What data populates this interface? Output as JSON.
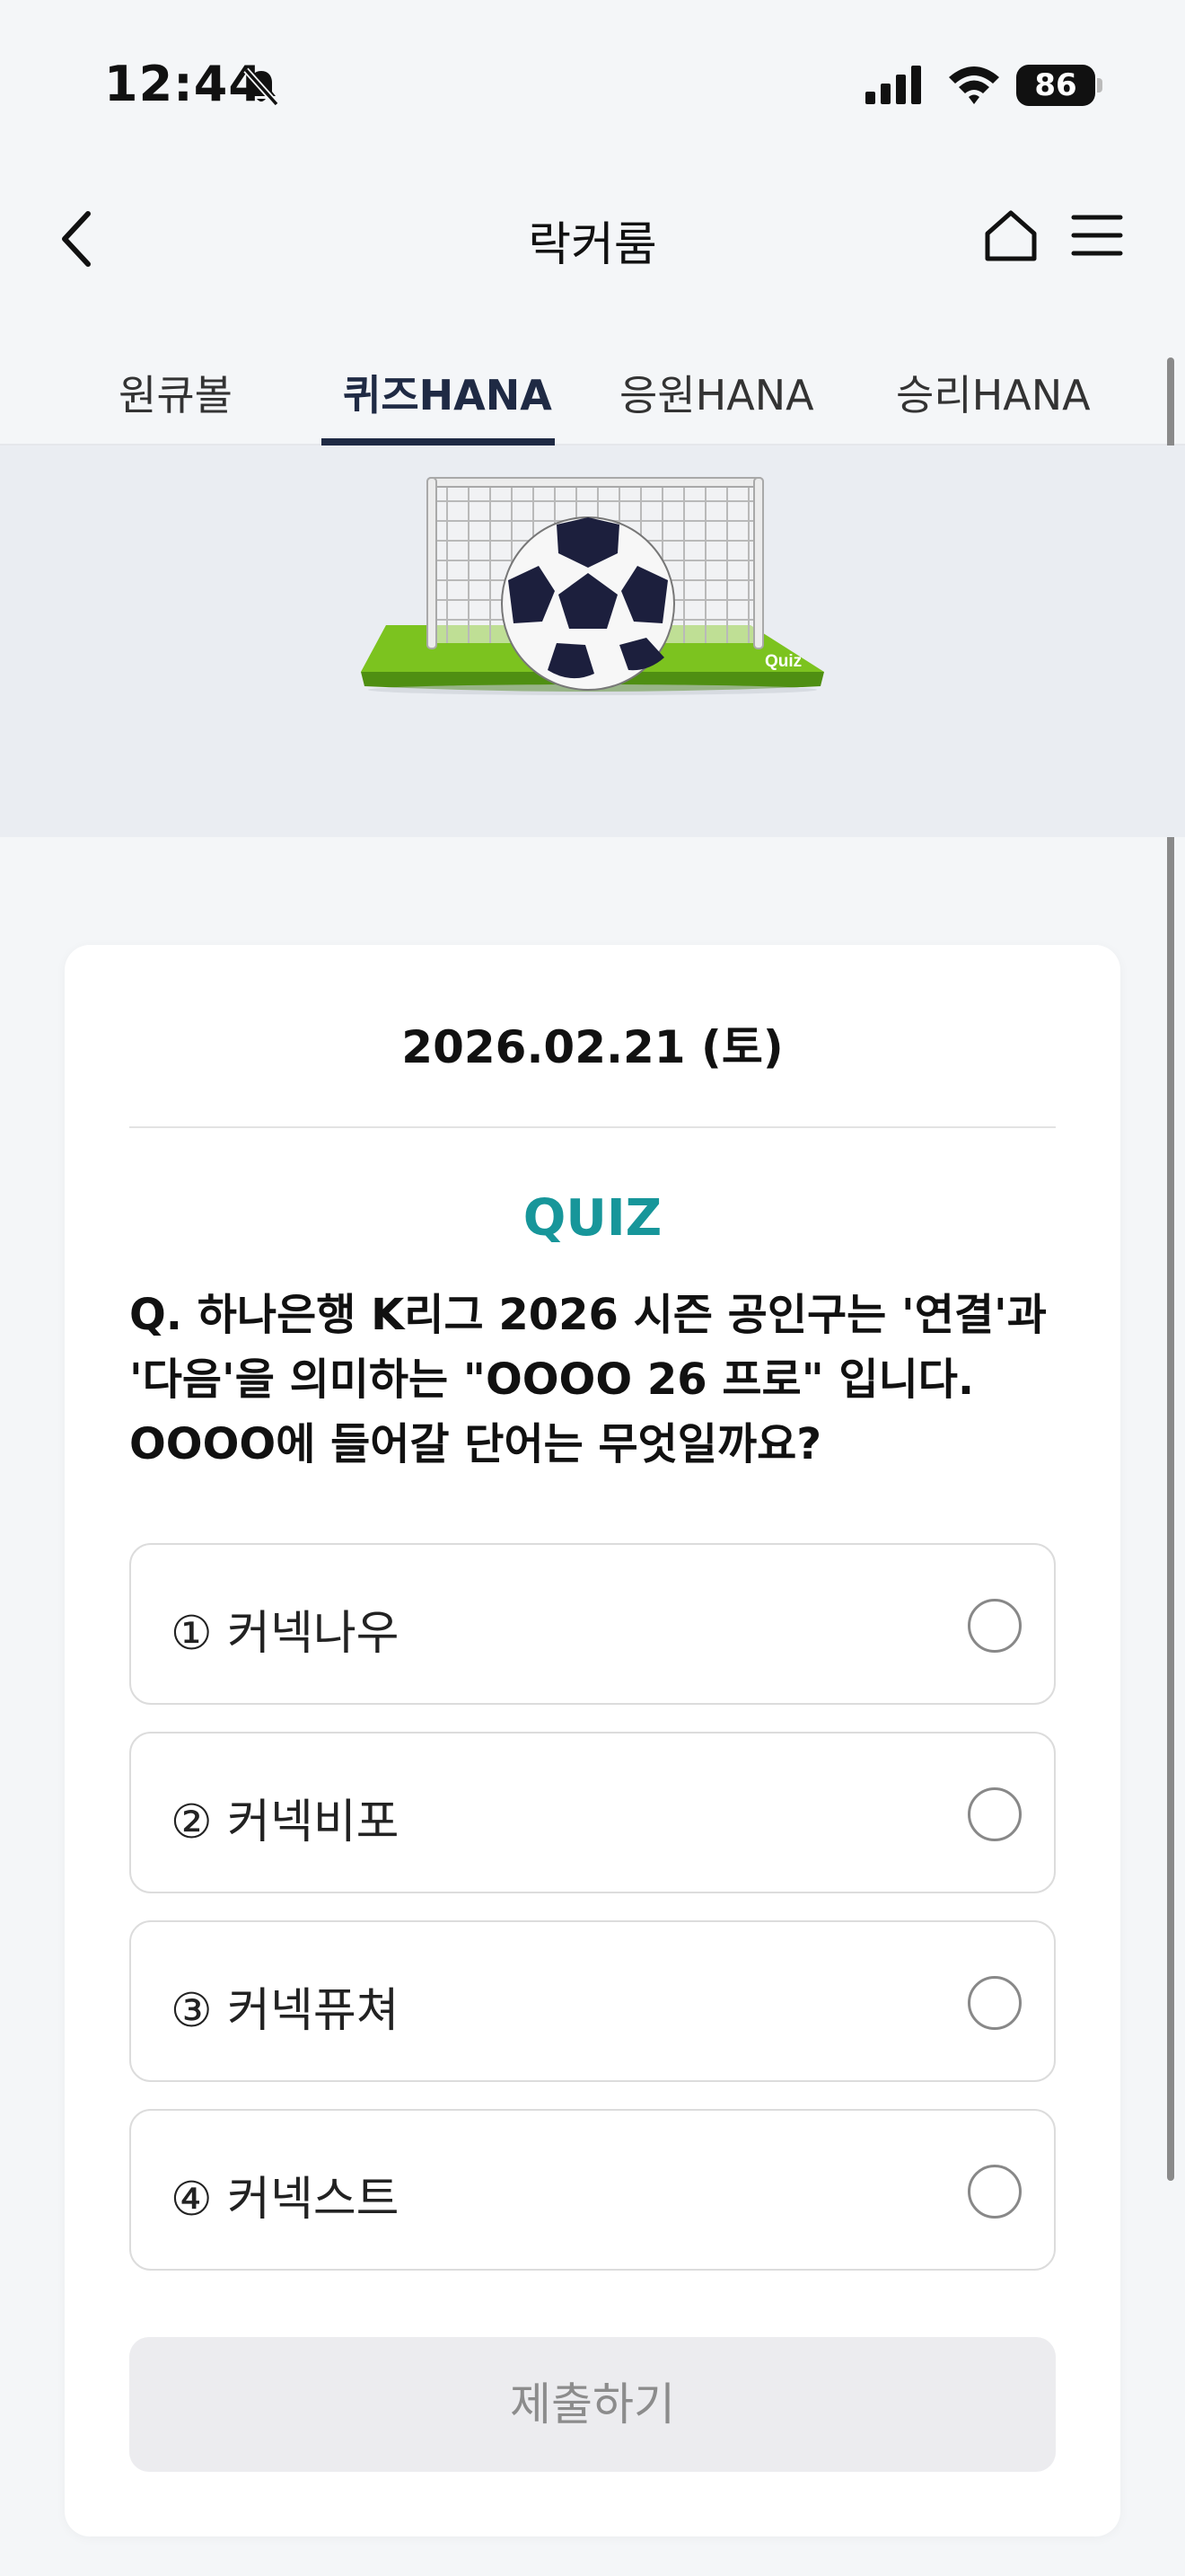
{
  "status_bar": {
    "time": "12:44",
    "battery": "86"
  },
  "header": {
    "title": "락커룸"
  },
  "tabs": [
    {
      "label": "원큐볼",
      "active": false
    },
    {
      "label": "퀴즈HANA",
      "active": true
    },
    {
      "label": "응원HANA",
      "active": false
    },
    {
      "label": "승리HANA",
      "active": false
    }
  ],
  "banner": {
    "badge": "Quiz"
  },
  "quiz": {
    "date": "2026.02.21 (토)",
    "label": "QUIZ",
    "question_lines": [
      "Q. 하나은행 K리그 2026 시즌 공인구는 '연결'과",
      "'다음'을 의미하는 \"OOOO 26 프로\" 입니다.",
      "OOOO에 들어갈 단어는 무엇일까요?"
    ],
    "options": [
      {
        "label": "① 커넥나우",
        "selected": false
      },
      {
        "label": "② 커넥비포",
        "selected": false
      },
      {
        "label": "③ 커넥퓨쳐",
        "selected": false
      },
      {
        "label": "④ 커넥스트",
        "selected": false
      }
    ],
    "submit_label": "제출하기"
  },
  "colors": {
    "accent": "#17969a",
    "tab_active": "#1f2a44",
    "background": "#f4f6f8"
  }
}
